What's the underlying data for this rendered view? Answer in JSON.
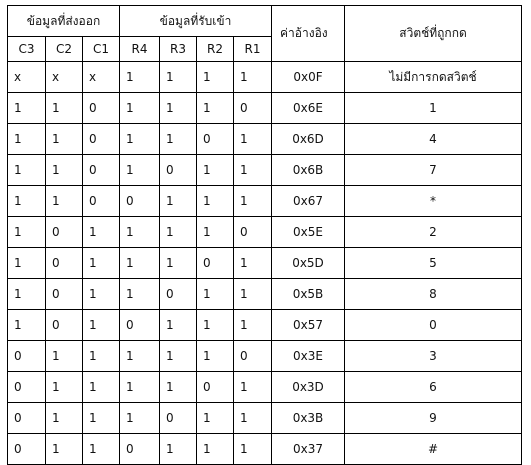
{
  "headers": {
    "output_group": "ข้อมูลที่ส่งออก",
    "input_group": "ข้อมูลที่รับเข้า",
    "reference": "ค่าอ้างอิง",
    "switch_pressed": "สวิตช์ที่ถูกกด",
    "columns": [
      "C3",
      "C2",
      "C1",
      "R4",
      "R3",
      "R2",
      "R1"
    ]
  },
  "rows": [
    {
      "c3": "x",
      "c2": "x",
      "c1": "x",
      "r4": "1",
      "r3": "1",
      "r2": "1",
      "r1": "1",
      "ref": "0x0F",
      "key": "ไม่มีการกดสวิตช์"
    },
    {
      "c3": "1",
      "c2": "1",
      "c1": "0",
      "r4": "1",
      "r3": "1",
      "r2": "1",
      "r1": "0",
      "ref": "0x6E",
      "key": "1"
    },
    {
      "c3": "1",
      "c2": "1",
      "c1": "0",
      "r4": "1",
      "r3": "1",
      "r2": "0",
      "r1": "1",
      "ref": "0x6D",
      "key": "4"
    },
    {
      "c3": "1",
      "c2": "1",
      "c1": "0",
      "r4": "1",
      "r3": "0",
      "r2": "1",
      "r1": "1",
      "ref": "0x6B",
      "key": "7"
    },
    {
      "c3": "1",
      "c2": "1",
      "c1": "0",
      "r4": "0",
      "r3": "1",
      "r2": "1",
      "r1": "1",
      "ref": "0x67",
      "key": "*"
    },
    {
      "c3": "1",
      "c2": "0",
      "c1": "1",
      "r4": "1",
      "r3": "1",
      "r2": "1",
      "r1": "0",
      "ref": "0x5E",
      "key": "2"
    },
    {
      "c3": "1",
      "c2": "0",
      "c1": "1",
      "r4": "1",
      "r3": "1",
      "r2": "0",
      "r1": "1",
      "ref": "0x5D",
      "key": "5"
    },
    {
      "c3": "1",
      "c2": "0",
      "c1": "1",
      "r4": "1",
      "r3": "0",
      "r2": "1",
      "r1": "1",
      "ref": "0x5B",
      "key": "8"
    },
    {
      "c3": "1",
      "c2": "0",
      "c1": "1",
      "r4": "0",
      "r3": "1",
      "r2": "1",
      "r1": "1",
      "ref": "0x57",
      "key": "0"
    },
    {
      "c3": "0",
      "c2": "1",
      "c1": "1",
      "r4": "1",
      "r3": "1",
      "r2": "1",
      "r1": "0",
      "ref": "0x3E",
      "key": "3"
    },
    {
      "c3": "0",
      "c2": "1",
      "c1": "1",
      "r4": "1",
      "r3": "1",
      "r2": "0",
      "r1": "1",
      "ref": "0x3D",
      "key": "6"
    },
    {
      "c3": "0",
      "c2": "1",
      "c1": "1",
      "r4": "1",
      "r3": "0",
      "r2": "1",
      "r1": "1",
      "ref": "0x3B",
      "key": "9"
    },
    {
      "c3": "0",
      "c2": "1",
      "c1": "1",
      "r4": "0",
      "r3": "1",
      "r2": "1",
      "r1": "1",
      "ref": "0x37",
      "key": "#"
    }
  ]
}
